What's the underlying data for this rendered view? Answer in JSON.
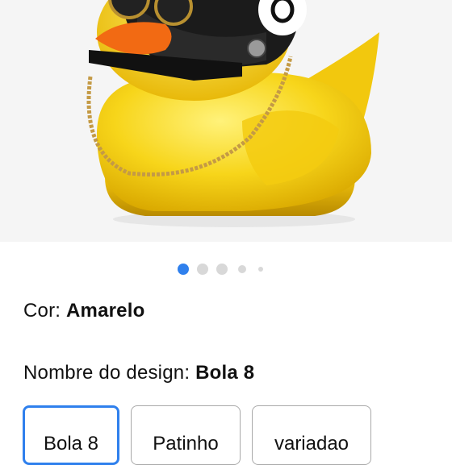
{
  "product": {
    "image_alt": "rubber-duck-with-helmet"
  },
  "carousel": {
    "dots": 5,
    "active_index": 0,
    "active_color": "#2f80ed",
    "inactive_color": "#d8d8d8"
  },
  "color": {
    "label": "Cor:",
    "value": "Amarelo"
  },
  "design": {
    "label": "Nombre do design:",
    "value": "Bola 8",
    "options": [
      {
        "label": "Bola 8",
        "selected": true
      },
      {
        "label": "Patinho",
        "selected": false
      },
      {
        "label": "variadao",
        "selected": false
      }
    ]
  }
}
